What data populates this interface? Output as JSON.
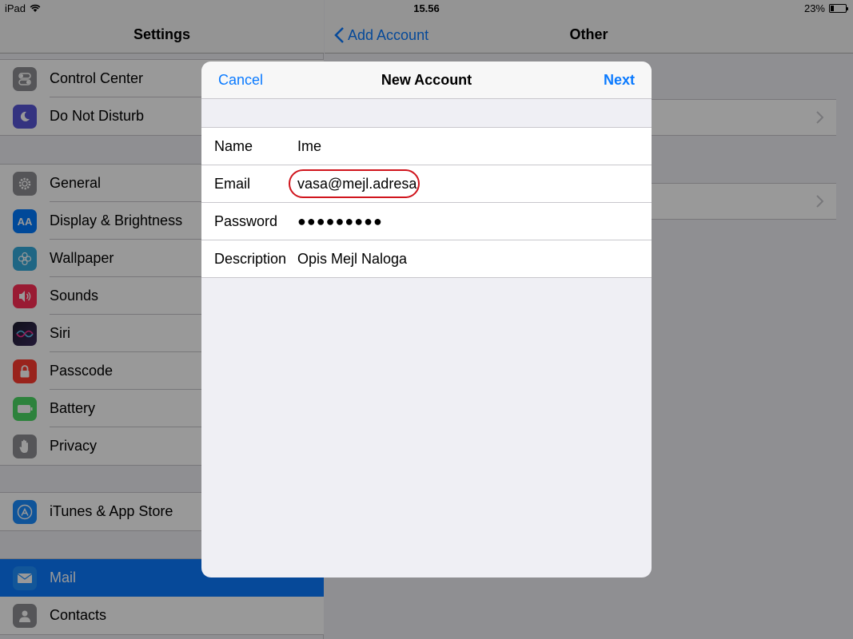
{
  "status_bar": {
    "carrier": "iPad",
    "time": "15.56",
    "battery": "23%",
    "battery_level": 0.23
  },
  "settings": {
    "title": "Settings",
    "groups": [
      {
        "items": [
          {
            "label": "Control Center",
            "icon": "control-center-icon",
            "color": "#8e8e93"
          },
          {
            "label": "Do Not Disturb",
            "icon": "moon-icon",
            "color": "#5856d6"
          }
        ]
      },
      {
        "items": [
          {
            "label": "General",
            "icon": "gear-icon",
            "color": "#8e8e93"
          },
          {
            "label": "Display & Brightness",
            "icon": "display-brightness-icon",
            "color": "#007aff",
            "glyph": "AA"
          },
          {
            "label": "Wallpaper",
            "icon": "wallpaper-flower-icon",
            "color": "#34aadc"
          },
          {
            "label": "Sounds",
            "icon": "speaker-icon",
            "color": "#ff2d55"
          },
          {
            "label": "Siri",
            "icon": "siri-icon",
            "color": "#1c1c2e"
          },
          {
            "label": "Passcode",
            "icon": "lock-icon",
            "color": "#ff3b30"
          },
          {
            "label": "Battery",
            "icon": "battery-icon",
            "color": "#4cd964"
          },
          {
            "label": "Privacy",
            "icon": "hand-icon",
            "color": "#8e8e93"
          }
        ]
      },
      {
        "items": [
          {
            "label": "iTunes & App Store",
            "icon": "app-store-icon",
            "color": "#1a8cff"
          }
        ]
      },
      {
        "items": [
          {
            "label": "Mail",
            "icon": "envelope-icon",
            "color": "#1e90ff",
            "selected": true
          },
          {
            "label": "Contacts",
            "icon": "contacts-icon",
            "color": "#8e8e93"
          }
        ]
      }
    ]
  },
  "detail": {
    "back_label": "Add Account",
    "title": "Other"
  },
  "modal": {
    "title": "New Account",
    "cancel_label": "Cancel",
    "next_label": "Next",
    "fields": [
      {
        "label": "Name",
        "value": "Ime"
      },
      {
        "label": "Email",
        "value": "vasa@mejl.adresa",
        "highlighted": true
      },
      {
        "label": "Password",
        "value": "●●●●●●●●●"
      },
      {
        "label": "Description",
        "value": "Opis Mejl Naloga"
      }
    ]
  },
  "colors": {
    "accent": "#0a7aff",
    "highlight_circle": "#d0141c"
  }
}
